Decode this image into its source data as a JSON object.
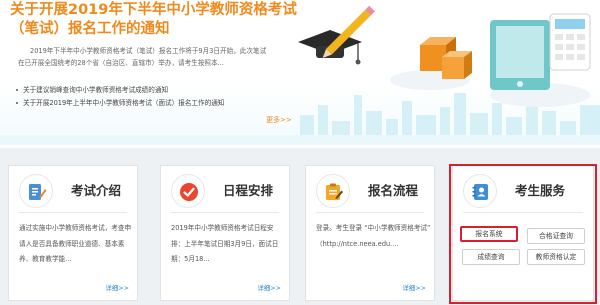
{
  "banner": {
    "title": "关于开展2019年下半年中小学教师资格考试（笔试）报名工作的通知",
    "desc_line1": "2019年下半年中小学教师资格考试（笔试）报名工作将于9月3日开始，此次笔试",
    "desc_line2": "在已开展全国统考的28个省（自治区、直辖市）举办，请考生按照本...",
    "links": [
      "关于建议销峰查询中小学教师资格考试成绩的通知",
      "关于开展2019年上半年中小学教师资格考试（面试）报名工作的通知"
    ],
    "more": "更多>>"
  },
  "cards": {
    "exam_intro": {
      "title": "考试介绍",
      "icon": "document-pen-icon",
      "body": "通过实施中小学教师资格考试，考查申请人是否具备教师职业道德、基本素养、教育教学能...",
      "more": "详细>>"
    },
    "schedule": {
      "title": "日程安排",
      "icon": "check-circle-icon",
      "body": "2019年中小学教师资格考试日程安排：上半年笔试日期3月9日，面试日期：5月18...",
      "more": "详细>>"
    },
    "process": {
      "title": "报名流程",
      "icon": "clipboard-pen-icon",
      "body": "登录。考生登录 “中小学教师资格考试” （http://ntce.neea.edu....",
      "more": "详细>>"
    },
    "services": {
      "title": "考生服务",
      "icon": "contact-book-icon",
      "buttons": [
        "报名系统",
        "合格证查询",
        "成绩查询",
        "教师资格认定"
      ]
    }
  },
  "colors": {
    "accent_orange": "#f08a1c",
    "link_blue": "#2f86c7",
    "highlight_red": "#d9202f"
  }
}
